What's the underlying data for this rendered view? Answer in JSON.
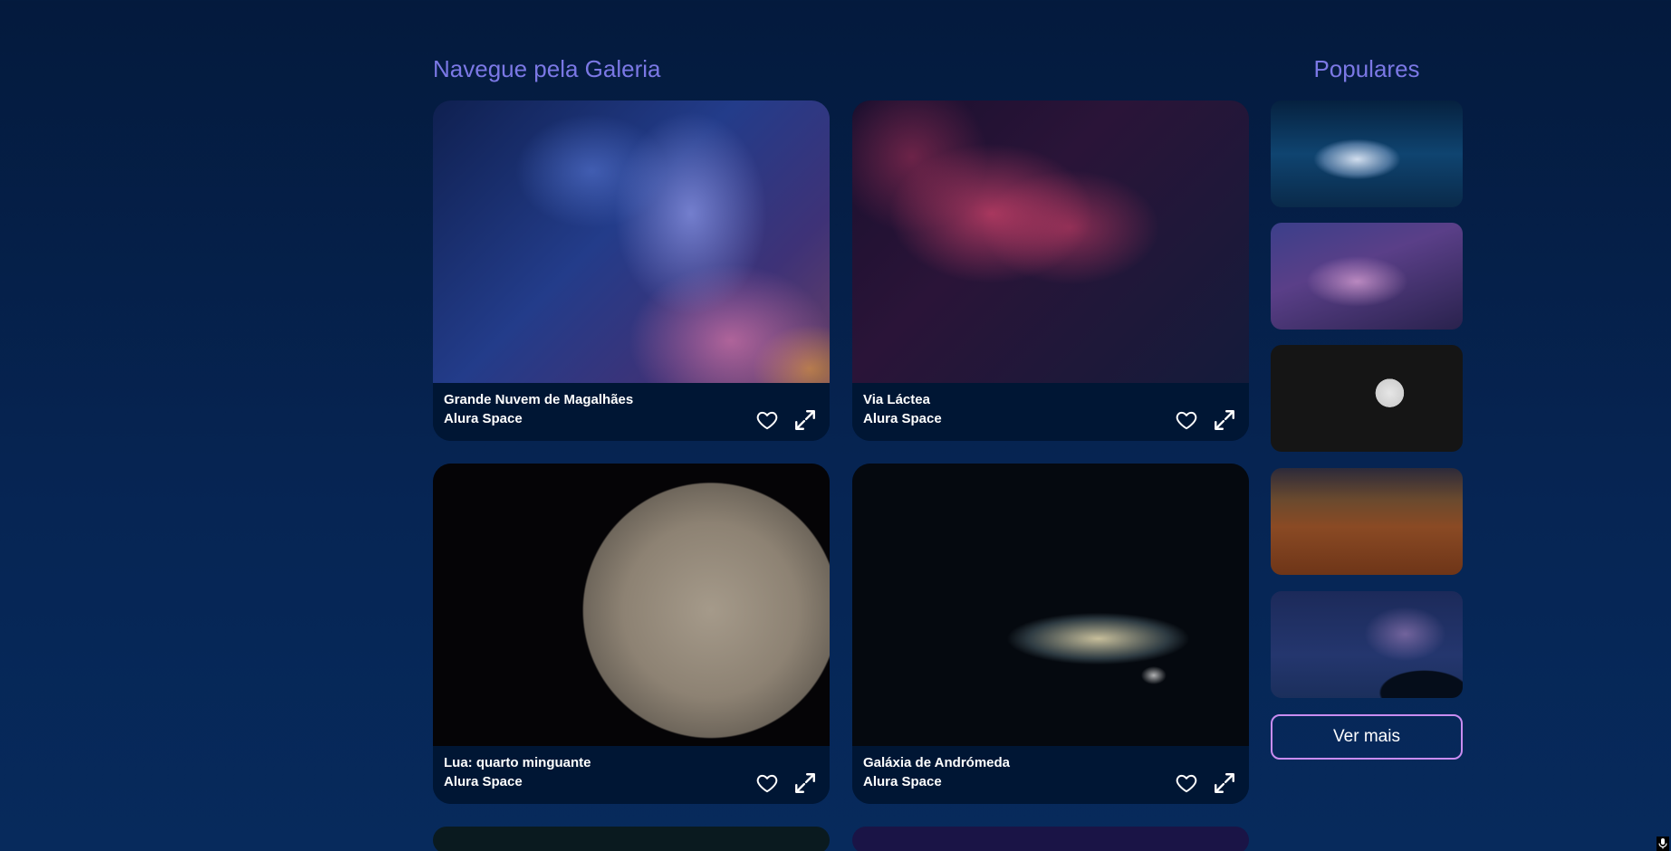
{
  "gallery": {
    "title": "Navegue pela Galeria",
    "cards": [
      {
        "title": "Grande Nuvem de Magalhães",
        "source": "Alura Space",
        "image": "magellanic-cloud-photo"
      },
      {
        "title": "Via Láctea",
        "source": "Alura Space",
        "image": "milky-way-red-photo"
      },
      {
        "title": "Lua: quarto minguante",
        "source": "Alura Space",
        "image": "moon-quarter-photo"
      },
      {
        "title": "Galáxia de Andrómeda",
        "source": "Alura Space",
        "image": "andromeda-photo"
      }
    ],
    "icons": {
      "favorite": "heart-outline-icon",
      "expand": "expand-arrows-icon"
    }
  },
  "popular": {
    "title": "Populares",
    "thumbnails": [
      "nebula-cloud",
      "milky-way-purple",
      "crescent-moon",
      "desert-dunes",
      "night-sky-tree"
    ],
    "see_more_label": "Ver mais"
  },
  "colors": {
    "background": "#041a3d",
    "heading": "#7b78e5",
    "card_footer": "#001634",
    "button_border": "#c98cf1"
  }
}
